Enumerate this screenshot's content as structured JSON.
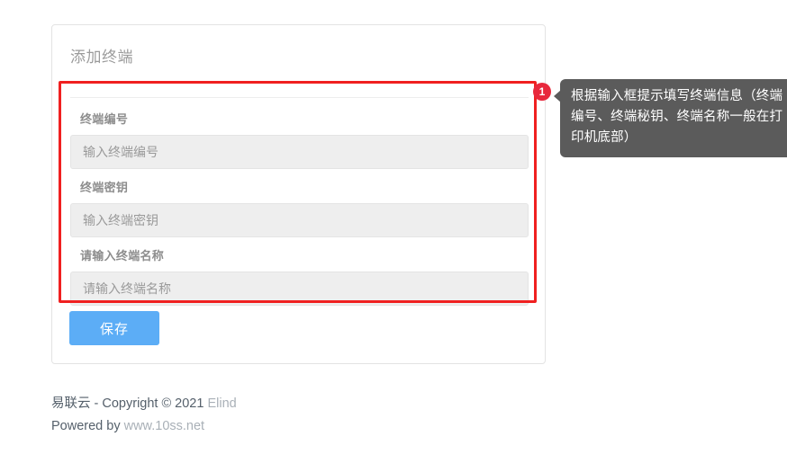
{
  "card": {
    "title": "添加终端",
    "fields": [
      {
        "label": "终端编号",
        "placeholder": "输入终端编号",
        "value": ""
      },
      {
        "label": "终端密钥",
        "placeholder": "输入终端密钥",
        "value": ""
      },
      {
        "label": "请输入终端名称",
        "placeholder": "请输入终端名称",
        "value": ""
      }
    ],
    "save_label": "保存"
  },
  "annotation": {
    "badge_number": "1",
    "text": "根据输入框提示填写终端信息（终端编号、终端秘钥、终端名称一般在打印机底部）"
  },
  "footer": {
    "line1_prefix": "易联云 - Copyright © 2021 ",
    "line1_brand": "Elind",
    "line2_prefix": "Powered by ",
    "line2_link": "www.10ss.net"
  },
  "colors": {
    "highlight_red": "#f02020",
    "badge_red": "#e8283c",
    "tooltip_gray": "#5b5b5b",
    "save_blue": "#5cadf6",
    "input_gray": "#eeeeee"
  }
}
